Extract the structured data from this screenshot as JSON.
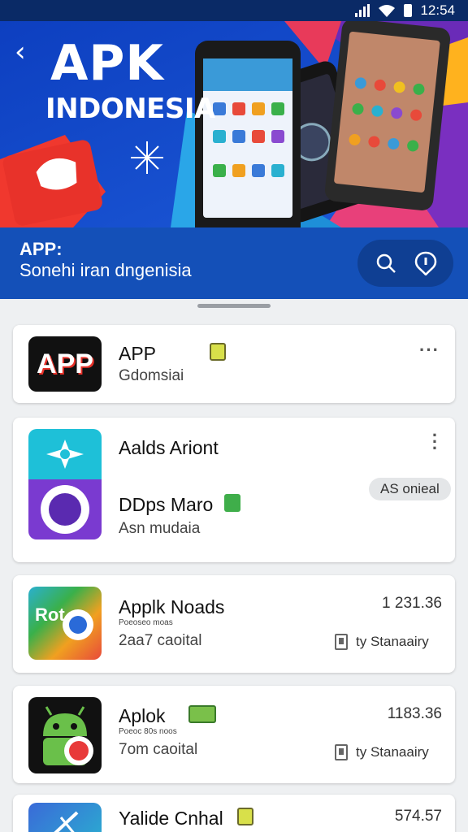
{
  "status_bar": {
    "time": "12:54"
  },
  "hero": {
    "title": "APK",
    "subtitle": "INDONESIA"
  },
  "band": {
    "title": "APP:",
    "subtitle": "Sonehi iran dngenisia"
  },
  "apps": [
    {
      "name": "APP",
      "subtitle": "Gdomsiai",
      "icon_text": "APP"
    },
    {
      "name": "Aalds Ariont",
      "name2": "DDps Maro",
      "subtitle": "Asn mudaia",
      "pill": "AS onieal"
    },
    {
      "name": "Applk Noads",
      "tiny": "Poeoseo moas",
      "subtitle": "2aa7 caoital",
      "number": "1 231.36",
      "meta": "ty  Stanaairy",
      "icon_text": "Rot"
    },
    {
      "name": "Aplok",
      "tiny": "Poeoc 80s noos",
      "subtitle": "7om caoital",
      "number": "1183.36",
      "meta": "ty  Stanaairy"
    },
    {
      "name": "Yalide Cnhal",
      "number": "574.57"
    }
  ],
  "icons": [
    "back-icon",
    "search-icon",
    "info-icon",
    "more-icon",
    "file-icon",
    "android-icon"
  ],
  "colors": {
    "header_blue": "#1347c4",
    "band_blue": "#1450b8",
    "card": "#ffffff",
    "page_bg": "#eef0f2"
  }
}
